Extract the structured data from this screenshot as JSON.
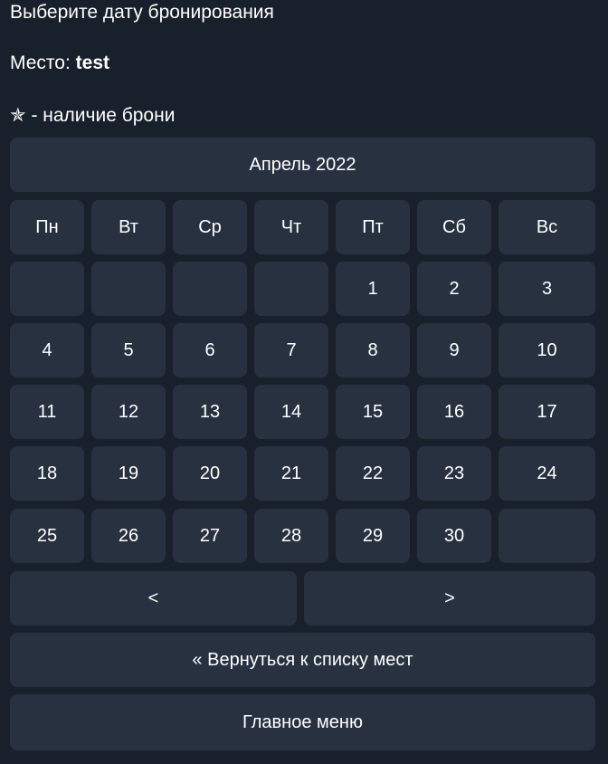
{
  "message": {
    "title": "Выберите дату бронирования",
    "place_label": "Место:",
    "place_value": "test",
    "legend_star": "✯",
    "legend_text": "- наличие брони"
  },
  "calendar": {
    "month_label": "Апрель 2022",
    "weekdays": [
      "Пн",
      "Вт",
      "Ср",
      "Чт",
      "Пт",
      "Сб",
      "Вс"
    ],
    "weeks": [
      [
        "",
        "",
        "",
        "",
        "1",
        "2",
        "3"
      ],
      [
        "4",
        "5",
        "6",
        "7",
        "8",
        "9",
        "10"
      ],
      [
        "11",
        "12",
        "13",
        "14",
        "15",
        "16",
        "17"
      ],
      [
        "18",
        "19",
        "20",
        "21",
        "22",
        "23",
        "24"
      ],
      [
        "25",
        "26",
        "27",
        "28",
        "29",
        "30",
        ""
      ]
    ]
  },
  "navigation": {
    "prev_label": "<",
    "next_label": ">"
  },
  "actions": {
    "back_label": "« Вернуться к списку мест",
    "main_menu_label": "Главное меню"
  },
  "colors": {
    "background": "#18202b",
    "button": "#273140",
    "text": "#ffffff"
  }
}
